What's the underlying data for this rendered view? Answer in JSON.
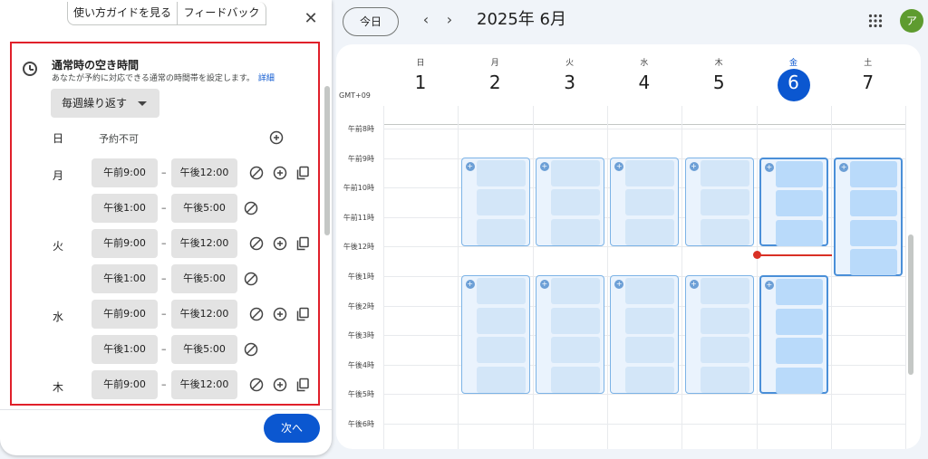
{
  "panel": {
    "tab_guide": "使い方ガイドを見る",
    "tab_feedback": "フィードバック",
    "close": "✕",
    "title": "通常時の空き時間",
    "subtitle": "あなたが予約に対応できる通常の時間帯を設定します。",
    "link": "詳細",
    "repeat": "毎週繰り返す",
    "sun_label": "日",
    "unavailable": "予約不可",
    "days": [
      {
        "label": "月",
        "slots": [
          [
            "午前9:00",
            "午後12:00"
          ],
          [
            "午後1:00",
            "午後5:00"
          ]
        ]
      },
      {
        "label": "火",
        "slots": [
          [
            "午前9:00",
            "午後12:00"
          ],
          [
            "午後1:00",
            "午後5:00"
          ]
        ]
      },
      {
        "label": "水",
        "slots": [
          [
            "午前9:00",
            "午後12:00"
          ],
          [
            "午後1:00",
            "午後5:00"
          ]
        ]
      },
      {
        "label": "木",
        "slots": [
          [
            "午前9:00",
            "午後12:00"
          ]
        ]
      }
    ],
    "dash": "–",
    "next": "次へ"
  },
  "toolbar": {
    "today": "今日",
    "prev": "‹",
    "next": "›",
    "month": "2025年 6月",
    "avatar": "ア"
  },
  "calendar": {
    "tz": "GMT+09",
    "days": [
      {
        "dow": "日",
        "num": "1"
      },
      {
        "dow": "月",
        "num": "2"
      },
      {
        "dow": "火",
        "num": "3"
      },
      {
        "dow": "水",
        "num": "4"
      },
      {
        "dow": "木",
        "num": "5"
      },
      {
        "dow": "金",
        "num": "6"
      },
      {
        "dow": "土",
        "num": "7"
      }
    ],
    "today_index": 5,
    "hours": [
      "午前8時",
      "午前9時",
      "午前10時",
      "午前11時",
      "午後12時",
      "午後1時",
      "午後2時",
      "午後3時",
      "午後4時",
      "午後5時",
      "午後6時"
    ],
    "today_color": "#0b57d0",
    "now_color": "#d93025"
  }
}
